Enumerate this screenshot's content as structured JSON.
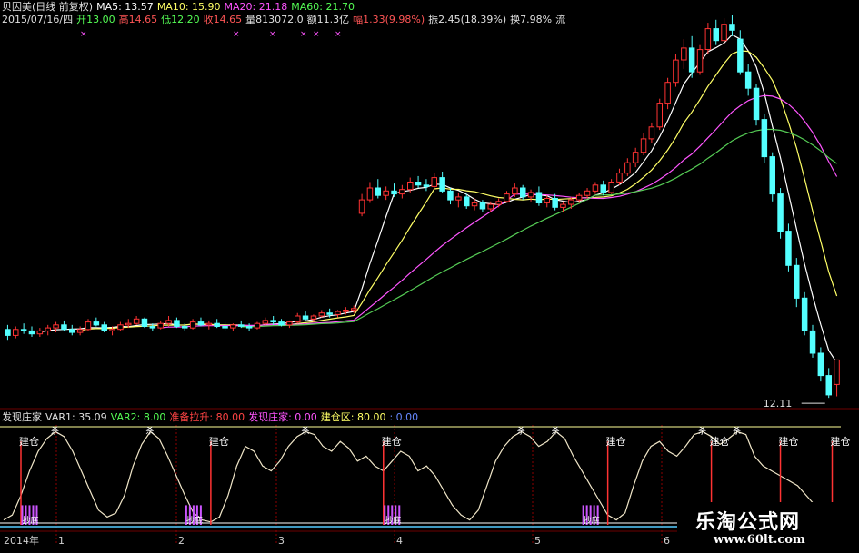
{
  "header": {
    "line1": [
      {
        "text": "贝因美(日线 前复权)",
        "color": "#e0e0e0"
      },
      {
        "text": "MA5: 13.57",
        "color": "#ffffff"
      },
      {
        "text": "MA10: 15.90",
        "color": "#ffff66"
      },
      {
        "text": "MA20: 21.18",
        "color": "#ff55ff"
      },
      {
        "text": "MA60: 21.70",
        "color": "#55ff55"
      }
    ],
    "line2": [
      {
        "text": "2015/07/16/四",
        "color": "#e0e0e0"
      },
      {
        "text": "开13.00",
        "color": "#55ff55"
      },
      {
        "text": "高14.65",
        "color": "#ff5555"
      },
      {
        "text": "低12.20",
        "color": "#55ff55"
      },
      {
        "text": "收14.65",
        "color": "#ff5555"
      },
      {
        "text": "量813072.0",
        "color": "#e0e0e0"
      },
      {
        "text": "额11.3亿",
        "color": "#e0e0e0"
      },
      {
        "text": "幅1.33(9.98%)",
        "color": "#ff5555"
      },
      {
        "text": "振2.45(18.39%)",
        "color": "#e0e0e0"
      },
      {
        "text": "换7.98%",
        "color": "#e0e0e0"
      },
      {
        "text": "流",
        "color": "#e0e0e0"
      }
    ]
  },
  "indicator": {
    "items": [
      {
        "text": "发现庄家",
        "color": "#e0e0e0"
      },
      {
        "text": "VAR1: 35.09",
        "color": "#e0e0e0"
      },
      {
        "text": "VAR2: 8.00",
        "color": "#55ff55"
      },
      {
        "text": "准备拉升: 80.00",
        "color": "#ff4444"
      },
      {
        "text": "发现庄家: 0.00",
        "color": "#ff55ff"
      },
      {
        "text": "建仓区: 80.00",
        "color": "#ffff66"
      },
      {
        "text": ": 0.00",
        "color": "#6688ff"
      }
    ],
    "signal_label": "建仓",
    "top_label": "杀",
    "bottom_label": "抄底"
  },
  "price_annotation": "12.11",
  "x_axis_labels": [
    "2014年",
    "1",
    "2",
    "3",
    "4",
    "5",
    "6"
  ],
  "watermark": {
    "title": "乐淘公式网",
    "url": "www.60lt.com"
  },
  "colors": {
    "up": "#ff3333",
    "down": "#54ffff",
    "ma5": "#ffffff",
    "ma10": "#ffff66",
    "ma20": "#ff55ff",
    "ma60": "#55cc55",
    "grid": "#8b0000"
  },
  "chart_data": {
    "type": "candlestick",
    "title": "贝因美(日线 前复权)",
    "x_tick_labels": [
      "2014年",
      "1",
      "2",
      "3",
      "4",
      "5",
      "6"
    ],
    "series": [
      {
        "name": "MA5",
        "last": 13.57
      },
      {
        "name": "MA10",
        "last": 15.9
      },
      {
        "name": "MA20",
        "last": 21.18
      },
      {
        "name": "MA60",
        "last": 21.7
      }
    ],
    "last_bar": {
      "date": "2015/07/16",
      "open": 13.0,
      "high": 14.65,
      "low": 12.2,
      "close": 14.65
    },
    "ylim": [
      11.5,
      37
    ],
    "candles": [
      [
        16.7,
        17.0,
        16.0,
        16.3
      ],
      [
        16.3,
        16.9,
        16.1,
        16.7
      ],
      [
        16.7,
        17.1,
        16.4,
        16.6
      ],
      [
        16.6,
        16.9,
        16.2,
        16.4
      ],
      [
        16.4,
        16.8,
        16.2,
        16.6
      ],
      [
        16.6,
        17.0,
        16.3,
        16.8
      ],
      [
        16.8,
        17.2,
        16.5,
        17.0
      ],
      [
        17.0,
        17.3,
        16.6,
        16.7
      ],
      [
        16.7,
        17.0,
        16.3,
        16.5
      ],
      [
        16.5,
        16.9,
        16.3,
        16.7
      ],
      [
        16.7,
        17.4,
        16.6,
        17.2
      ],
      [
        17.2,
        17.5,
        16.9,
        17.0
      ],
      [
        17.0,
        17.2,
        16.5,
        16.6
      ],
      [
        16.6,
        16.9,
        16.3,
        16.7
      ],
      [
        16.7,
        17.2,
        16.6,
        17.0
      ],
      [
        17.0,
        17.4,
        16.8,
        17.1
      ],
      [
        17.1,
        17.6,
        17.0,
        17.4
      ],
      [
        17.4,
        17.5,
        16.8,
        16.9
      ],
      [
        16.9,
        17.1,
        16.6,
        16.8
      ],
      [
        16.8,
        17.3,
        16.7,
        17.1
      ],
      [
        17.1,
        17.6,
        16.9,
        17.3
      ],
      [
        17.3,
        17.5,
        16.8,
        16.9
      ],
      [
        16.9,
        17.1,
        16.6,
        16.8
      ],
      [
        16.8,
        17.4,
        16.7,
        17.2
      ],
      [
        17.2,
        17.5,
        16.9,
        17.0
      ],
      [
        17.0,
        17.3,
        16.7,
        17.1
      ],
      [
        17.1,
        17.4,
        16.8,
        16.9
      ],
      [
        16.9,
        17.2,
        16.6,
        16.8
      ],
      [
        16.8,
        17.1,
        16.6,
        17.0
      ],
      [
        17.0,
        17.3,
        16.8,
        16.9
      ],
      [
        16.9,
        17.1,
        16.6,
        16.8
      ],
      [
        16.8,
        17.2,
        16.7,
        17.1
      ],
      [
        17.1,
        17.5,
        17.0,
        17.3
      ],
      [
        17.3,
        17.6,
        17.0,
        17.2
      ],
      [
        17.2,
        17.4,
        16.9,
        17.0
      ],
      [
        17.0,
        17.3,
        16.8,
        17.2
      ],
      [
        17.2,
        17.8,
        17.1,
        17.6
      ],
      [
        17.6,
        17.9,
        17.3,
        17.4
      ],
      [
        17.4,
        17.7,
        17.2,
        17.6
      ],
      [
        17.6,
        18.0,
        17.5,
        17.8
      ],
      [
        17.8,
        18.1,
        17.5,
        17.7
      ],
      [
        17.7,
        18.0,
        17.5,
        17.9
      ],
      [
        17.9,
        18.2,
        17.7,
        18.0
      ],
      [
        18.0,
        18.3,
        17.8,
        18.1
      ],
      [
        24.5,
        25.8,
        24.3,
        25.4
      ],
      [
        25.4,
        26.6,
        25.2,
        26.2
      ],
      [
        26.2,
        26.8,
        25.5,
        25.7
      ],
      [
        25.7,
        26.3,
        25.4,
        26.0
      ],
      [
        26.0,
        26.5,
        25.6,
        25.8
      ],
      [
        25.8,
        26.4,
        25.5,
        26.1
      ],
      [
        26.1,
        26.9,
        25.9,
        26.6
      ],
      [
        26.6,
        27.0,
        26.2,
        26.4
      ],
      [
        26.4,
        26.8,
        26.0,
        26.3
      ],
      [
        26.3,
        27.2,
        26.1,
        26.9
      ],
      [
        26.9,
        27.3,
        25.9,
        26.0
      ],
      [
        26.0,
        26.2,
        25.1,
        25.4
      ],
      [
        25.4,
        25.9,
        24.9,
        25.6
      ],
      [
        25.6,
        25.8,
        24.8,
        25.0
      ],
      [
        25.0,
        25.5,
        24.7,
        25.2
      ],
      [
        25.2,
        25.4,
        24.6,
        24.8
      ],
      [
        24.8,
        25.3,
        24.6,
        25.1
      ],
      [
        25.1,
        25.5,
        24.9,
        25.3
      ],
      [
        25.3,
        26.0,
        25.2,
        25.8
      ],
      [
        25.8,
        26.5,
        25.6,
        26.2
      ],
      [
        26.2,
        26.4,
        25.4,
        25.6
      ],
      [
        25.6,
        26.1,
        25.3,
        25.9
      ],
      [
        25.9,
        26.3,
        25.0,
        25.2
      ],
      [
        25.2,
        25.7,
        24.9,
        25.5
      ],
      [
        25.5,
        25.8,
        24.7,
        24.9
      ],
      [
        24.9,
        25.3,
        24.6,
        25.1
      ],
      [
        25.1,
        25.6,
        24.8,
        25.4
      ],
      [
        25.4,
        25.9,
        25.2,
        25.7
      ],
      [
        25.7,
        26.2,
        25.5,
        26.0
      ],
      [
        26.0,
        26.6,
        25.8,
        26.4
      ],
      [
        26.4,
        26.7,
        25.7,
        25.9
      ],
      [
        25.9,
        26.8,
        25.8,
        26.6
      ],
      [
        26.6,
        27.5,
        26.4,
        27.2
      ],
      [
        27.2,
        28.2,
        27.0,
        27.9
      ],
      [
        27.9,
        28.9,
        27.6,
        28.6
      ],
      [
        28.6,
        29.9,
        28.4,
        29.5
      ],
      [
        29.5,
        30.6,
        29.2,
        30.3
      ],
      [
        30.3,
        32.2,
        30.1,
        31.9
      ],
      [
        31.9,
        33.6,
        31.5,
        33.3
      ],
      [
        33.3,
        35.2,
        33.0,
        34.8
      ],
      [
        34.8,
        36.2,
        34.2,
        35.6
      ],
      [
        35.6,
        36.4,
        33.6,
        34.0
      ],
      [
        34.0,
        35.8,
        33.8,
        35.5
      ],
      [
        35.5,
        37.3,
        35.2,
        36.9
      ],
      [
        36.9,
        37.5,
        35.8,
        36.1
      ],
      [
        36.1,
        37.6,
        35.9,
        37.2
      ],
      [
        37.2,
        37.8,
        36.4,
        36.8
      ],
      [
        36.2,
        36.8,
        33.8,
        34.0
      ],
      [
        34.0,
        34.5,
        32.4,
        32.9
      ],
      [
        32.9,
        33.2,
        30.4,
        30.8
      ],
      [
        30.8,
        31.2,
        27.9,
        28.3
      ],
      [
        28.3,
        28.6,
        25.3,
        25.8
      ],
      [
        25.8,
        26.2,
        22.8,
        23.3
      ],
      [
        23.3,
        23.8,
        20.6,
        21.0
      ],
      [
        21.0,
        21.5,
        18.2,
        18.8
      ],
      [
        18.8,
        19.2,
        16.3,
        16.6
      ],
      [
        16.6,
        17.0,
        14.8,
        15.1
      ],
      [
        15.1,
        15.5,
        13.2,
        13.6
      ],
      [
        13.6,
        14.1,
        12.1,
        12.3
      ],
      [
        13.0,
        14.65,
        12.2,
        14.65
      ]
    ],
    "indicator": {
      "name": "发现庄家",
      "ylim": [
        0,
        100
      ],
      "values": [
        5,
        10,
        30,
        55,
        75,
        88,
        95,
        90,
        75,
        55,
        35,
        15,
        8,
        12,
        30,
        60,
        82,
        95,
        88,
        70,
        50,
        30,
        12,
        5,
        3,
        8,
        30,
        60,
        80,
        75,
        60,
        55,
        65,
        80,
        90,
        95,
        92,
        80,
        75,
        85,
        78,
        65,
        70,
        60,
        55,
        65,
        75,
        70,
        55,
        60,
        50,
        35,
        20,
        10,
        5,
        15,
        40,
        65,
        80,
        90,
        95,
        90,
        80,
        85,
        95,
        88,
        70,
        55,
        40,
        25,
        10,
        5,
        12,
        40,
        65,
        80,
        85,
        75,
        70,
        80,
        92,
        95,
        90,
        82,
        88,
        95,
        92,
        70,
        60,
        55,
        50,
        45,
        40,
        30,
        20,
        10,
        5,
        2
      ],
      "bottom_points": [
        3,
        22,
        45,
        68
      ],
      "signal_points": [
        2,
        24,
        44,
        70,
        82,
        90,
        96
      ]
    }
  }
}
